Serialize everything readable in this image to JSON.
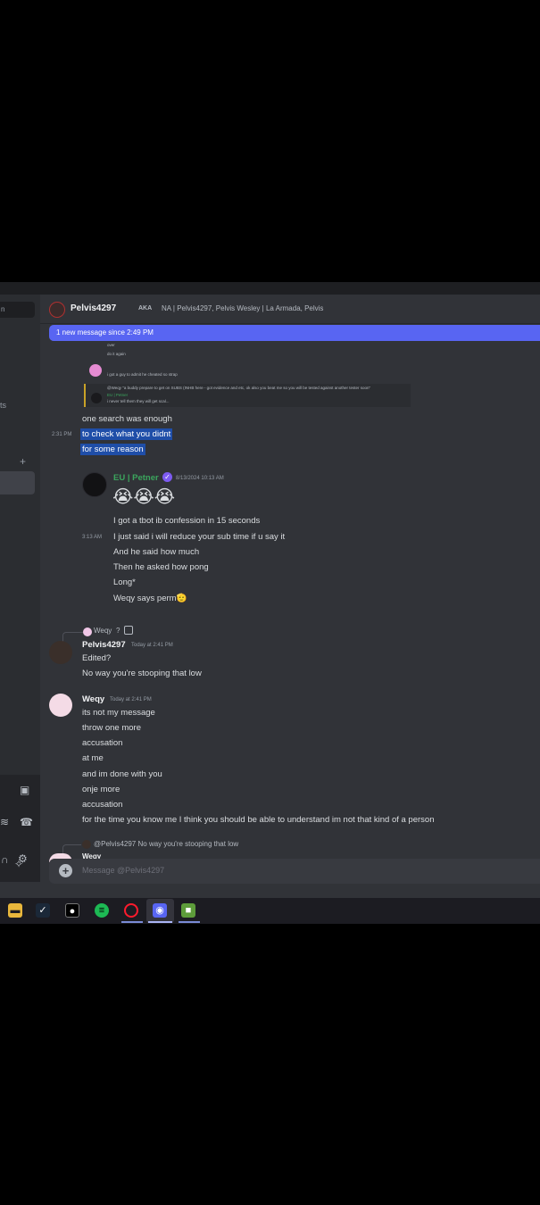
{
  "sidebar": {
    "search_partial": "n",
    "item_partial": "ts",
    "add_symbol": "+"
  },
  "header": {
    "username": "Pelvis4297",
    "aka_label": "AKA",
    "aka_names": "NA | Pelvis4297, Pelvis Wesley | La Armada, Pelvis"
  },
  "new_message_bar": "1 new message since 2:49 PM",
  "quoted": {
    "line1": "over",
    "line2": "do it again",
    "line3": "i got a guy to admit he cheated so strap",
    "reply_line": "@Weqy \"a buddy prepare to get on SUBS (INHB here - got evidence and etc, ok also you beat me so you will be tested against another tester soon\"",
    "reply_name": "EU | Petner",
    "reply_text": "i never tell them they will get scal..."
  },
  "messages_top": {
    "m1": "one search was enough",
    "time": "2:31 PM",
    "m2": "to check what you didnt",
    "m3": "for some reason"
  },
  "petner": {
    "name": "EU | Petner",
    "timestamp": "8/13/2024 10:13 AM",
    "emojis": "😭😭😭",
    "line1": "I got a tbot ib confession in 15 seconds",
    "time2": "3:13 AM",
    "line2": "I just said i will reduce your sub time if u say it",
    "line3": "And he said how much",
    "line4": "Then he asked how pong",
    "line5": "Long*",
    "line6": "Weqy says perm",
    "line6_emoji": "🫡"
  },
  "pelvis_reply": {
    "reply_to": "Weqy",
    "reply_marker": "?",
    "name": "Pelvis4297",
    "timestamp": "Today at 2:41 PM",
    "line1": "Edited?",
    "line2": "No way you're stooping that low"
  },
  "weqy": {
    "name": "Weqy",
    "timestamp": "Today at 2:41 PM",
    "lines": [
      "its not my message",
      "throw one more",
      "accusation",
      "at me",
      "and im done with you",
      "onje more",
      "accusation",
      "for the time you know me I think you should be able to understand im not that kind of a person"
    ]
  },
  "bottom_reply": {
    "mention": "@Pelvis4297",
    "text": "No way you're stooping that low",
    "cut_name": "Weqy"
  },
  "composer": {
    "placeholder": "Message @Pelvis4297"
  },
  "taskbar": {
    "apps": [
      "file-explorer",
      "steam",
      "obs",
      "spotify",
      "opera-gx",
      "discord",
      "minecraft"
    ]
  },
  "colors": {
    "accent": "#5865f2",
    "petner_name": "#3ba55d",
    "selection": "#1f4ea8",
    "background": "#313338"
  }
}
